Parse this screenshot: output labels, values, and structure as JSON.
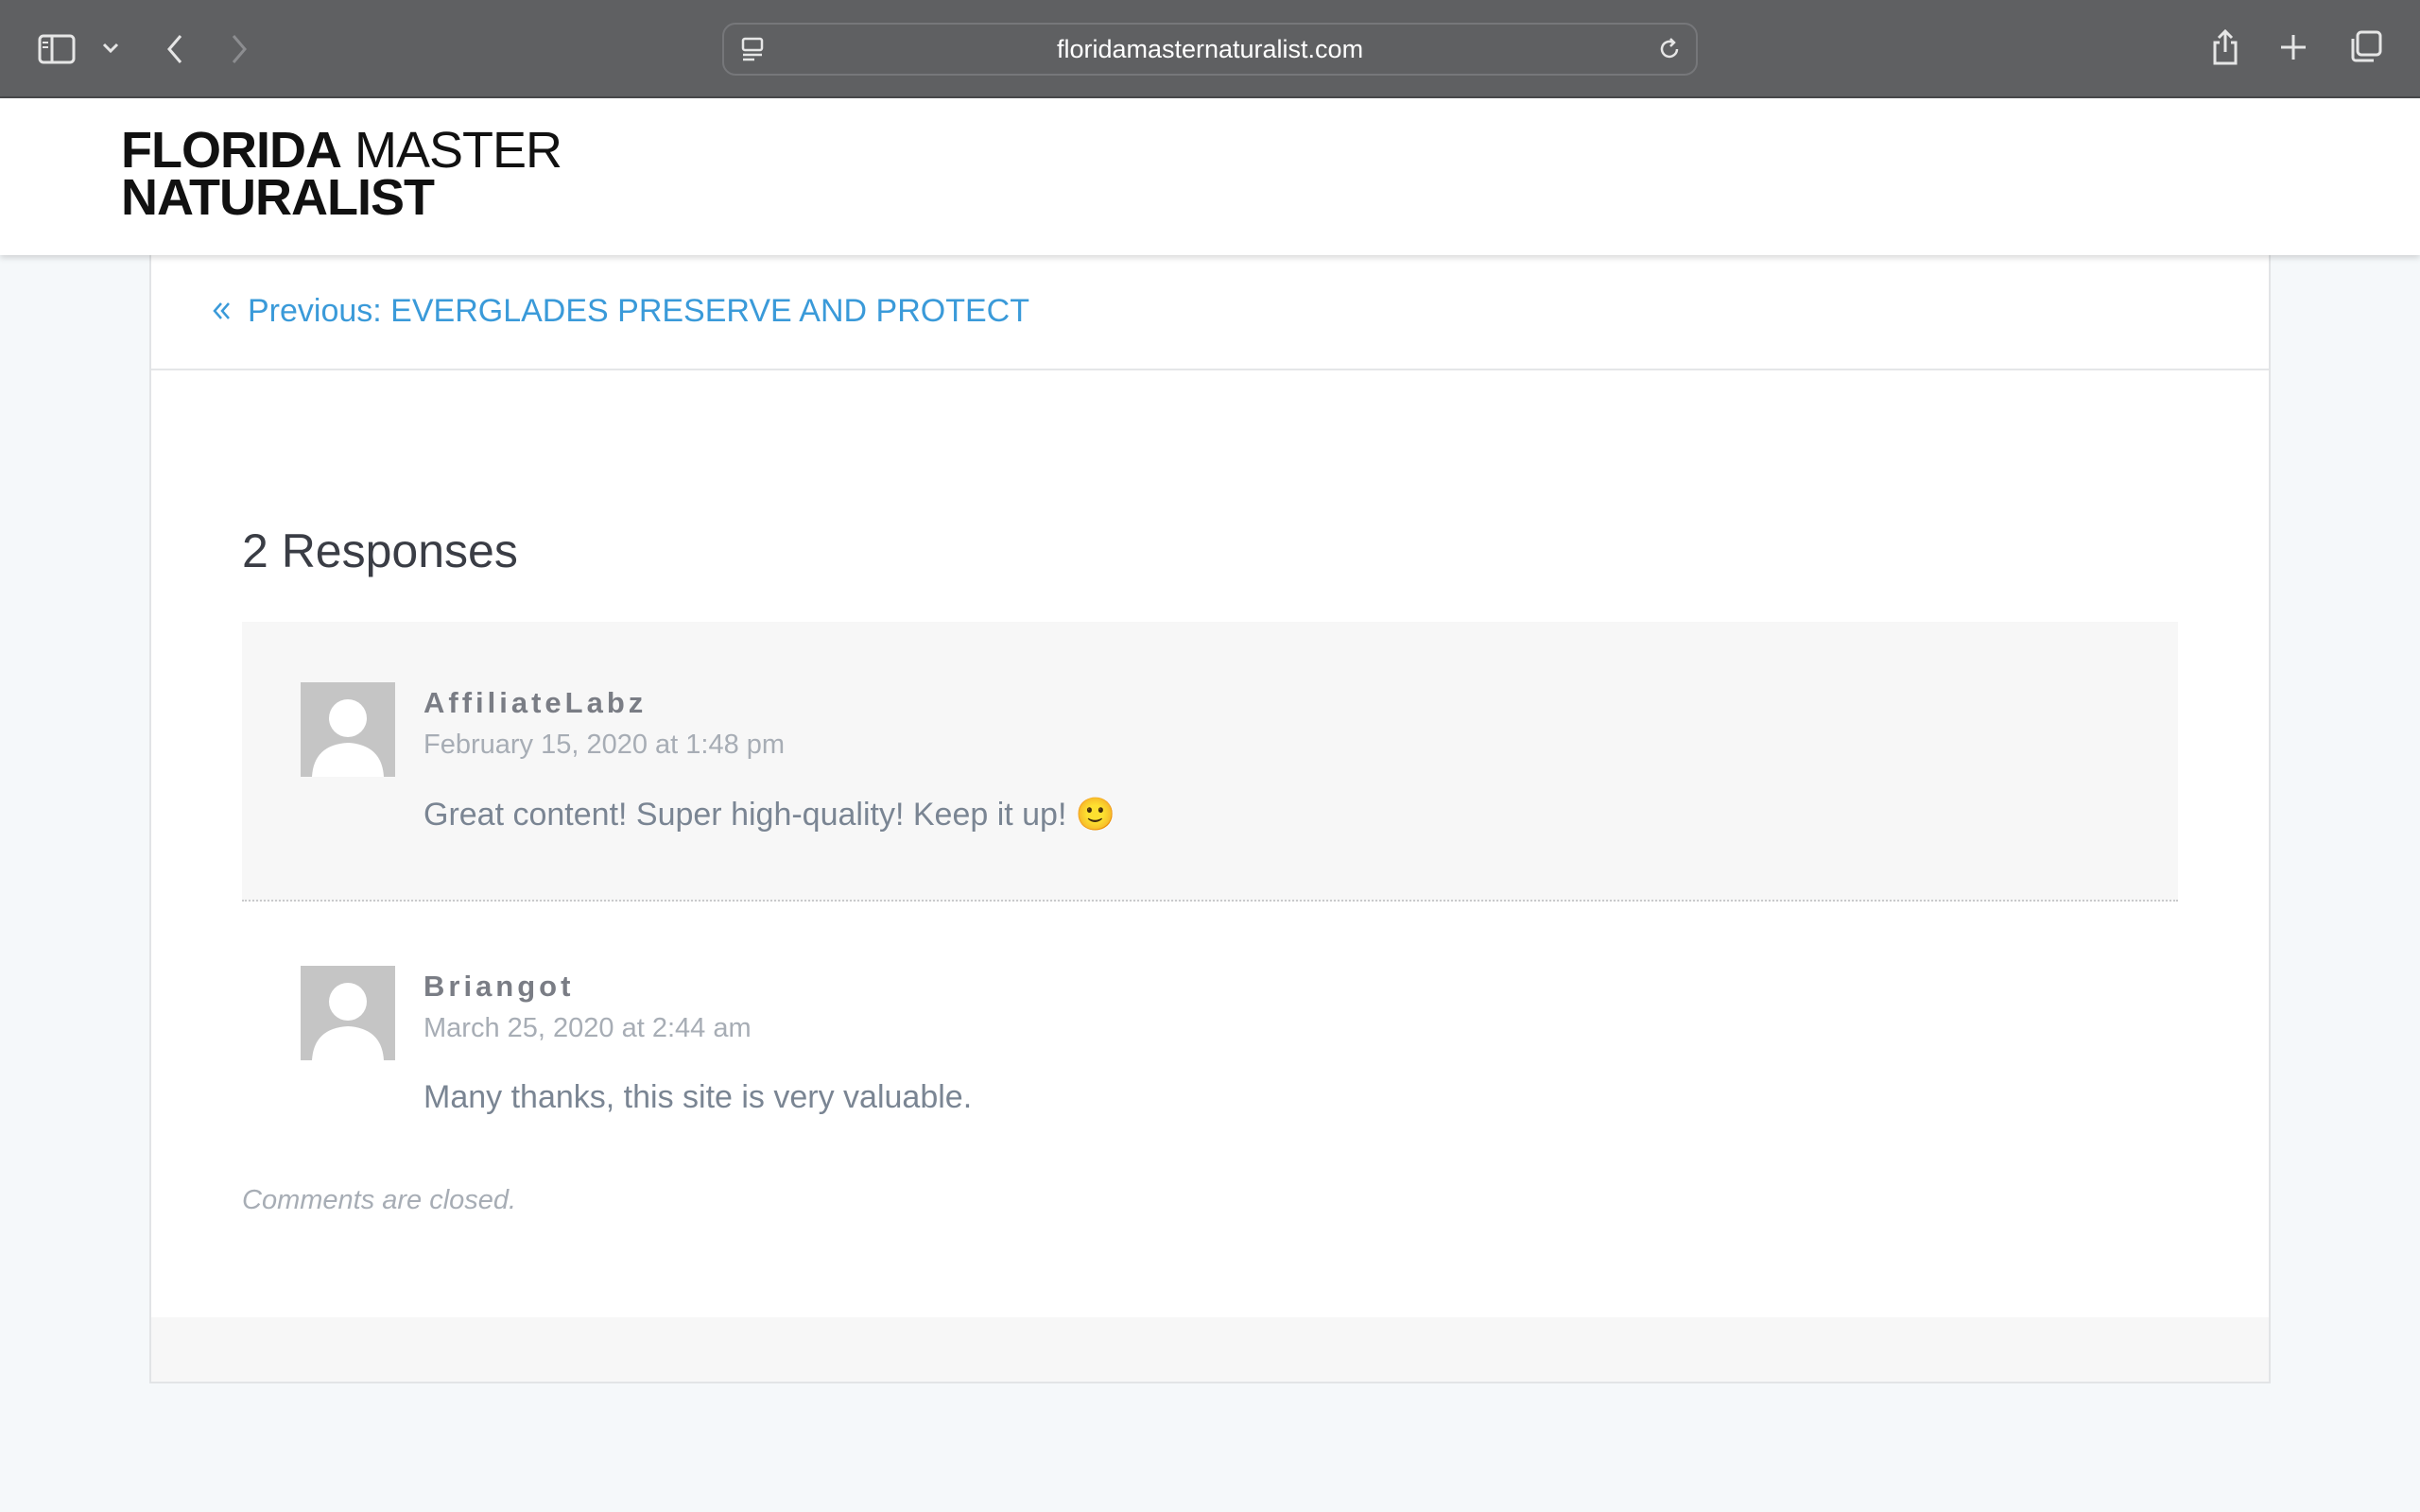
{
  "browser": {
    "url": "floridamasternaturalist.com",
    "icons": [
      "sidebar-icon",
      "chevron-down-icon",
      "back-icon",
      "forward-icon",
      "page-icon",
      "reload-icon",
      "share-icon",
      "plus-icon",
      "tabs-icon"
    ]
  },
  "site": {
    "logo_word1": "FLORIDA",
    "logo_word2": "MASTER",
    "logo_word3": "NATURALIST"
  },
  "post_nav": {
    "previous_label": "Previous: EVERGLADES PRESERVE AND PROTECT"
  },
  "comments": {
    "title": "2 Responses",
    "items": [
      {
        "author": "AffiliateLabz",
        "date": "February 15, 2020 at 1:48 pm",
        "text": "Great content! Super high-quality! Keep it up! 🙂"
      },
      {
        "author": "Briangot",
        "date": "March 25, 2020 at 2:44 am",
        "text": "Many thanks, this site is very valuable."
      }
    ],
    "closed_text": "Comments are closed."
  },
  "colors": {
    "toolbar": "#5f6062",
    "link": "#3a9ad9",
    "page_bg": "#f5f8fa"
  }
}
